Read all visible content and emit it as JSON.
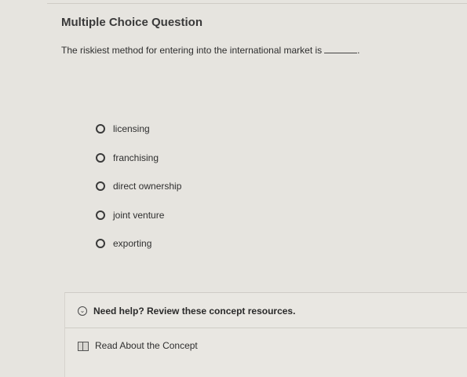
{
  "header": {
    "title": "Multiple Choice Question"
  },
  "question": {
    "text": "The riskiest method for entering into the international market is",
    "suffix": "."
  },
  "options": [
    {
      "label": "licensing"
    },
    {
      "label": "franchising"
    },
    {
      "label": "direct ownership"
    },
    {
      "label": "joint venture"
    },
    {
      "label": "exporting"
    }
  ],
  "help": {
    "icon": "chevron-down-icon",
    "text": "Need help? Review these concept resources.",
    "resource_icon": "book-icon",
    "resource_label": "Read About the Concept"
  }
}
